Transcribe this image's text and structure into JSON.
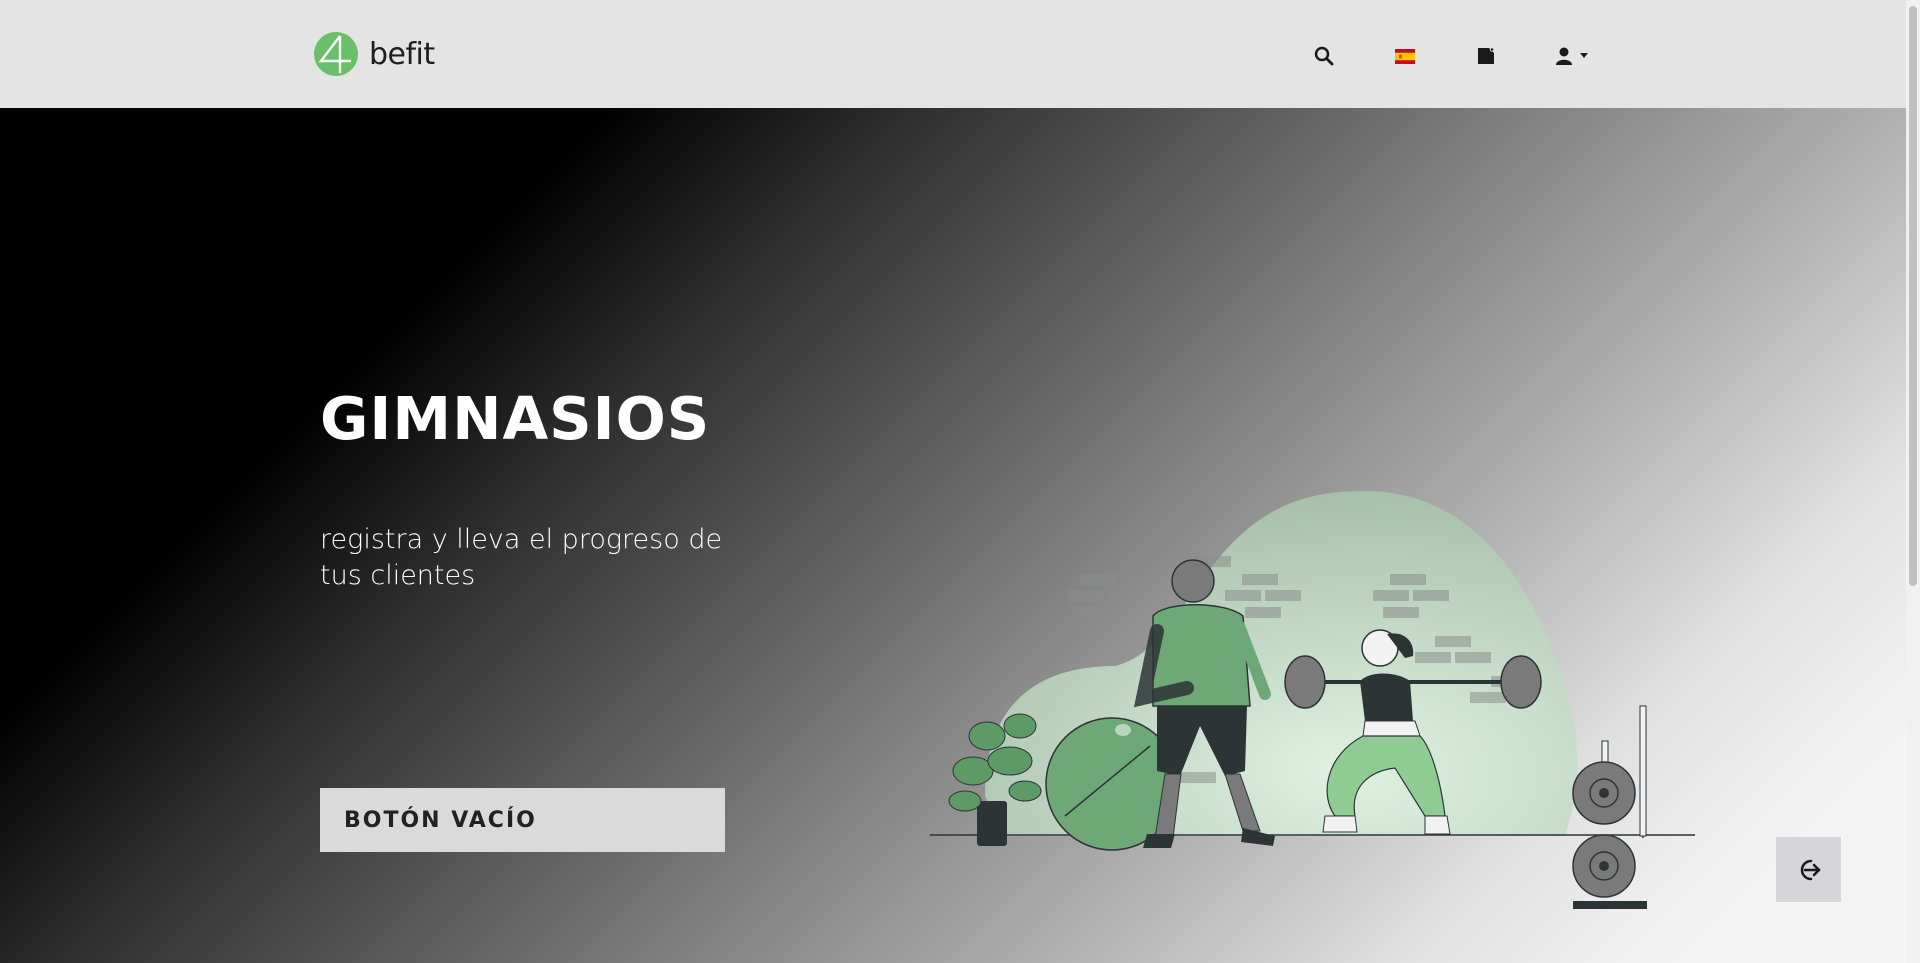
{
  "header": {
    "logo_text": "befit",
    "icons": [
      "search-icon",
      "spain-flag-icon",
      "note-icon",
      "user-icon",
      "caret-down-icon"
    ]
  },
  "hero": {
    "title": "GIMNASIOS",
    "subtitle": "registra y lleva el progreso de tus clientes",
    "button_label": "BOTÓN VACÍO",
    "side_button_icon": "sign-out-icon"
  },
  "colors": {
    "brand_green": "#6abf69",
    "header_bg": "#e4e4e4",
    "button_bg": "#dadada"
  }
}
